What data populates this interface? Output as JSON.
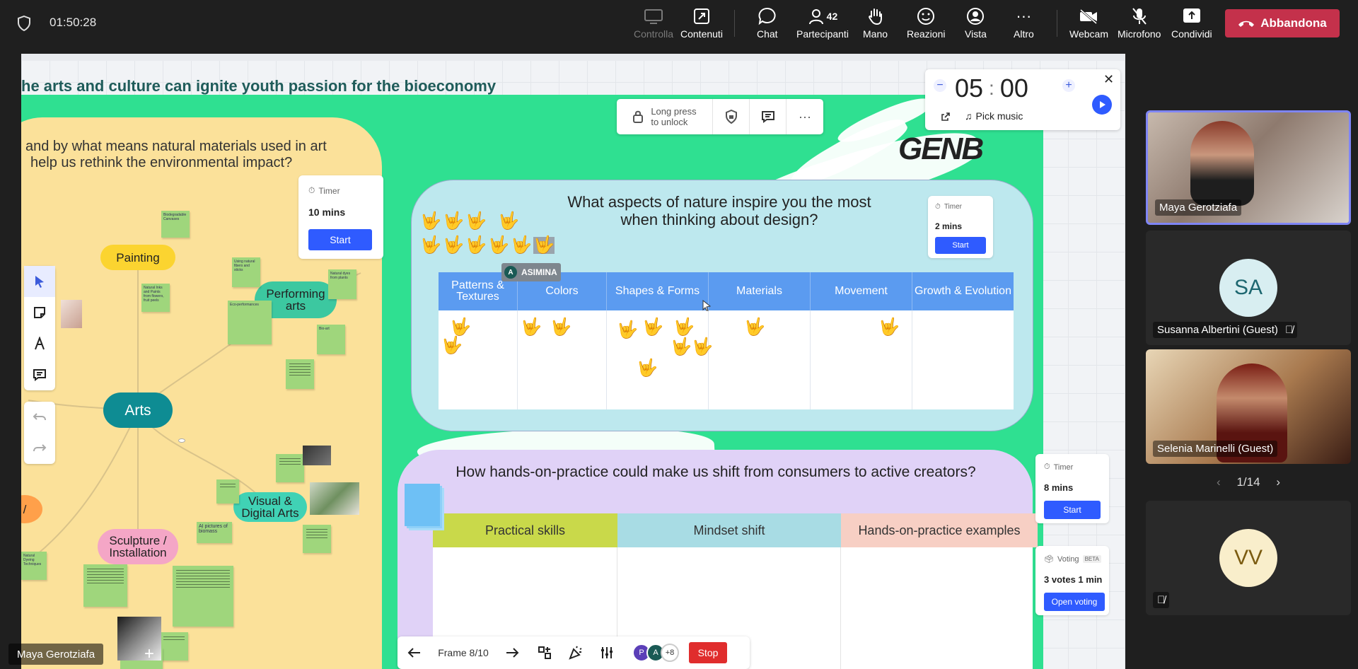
{
  "meeting": {
    "elapsed": "01:50:28",
    "toolbar": {
      "control": "Controlla",
      "content": "Contenuti",
      "chat": "Chat",
      "participants": "Partecipanti",
      "participants_count": "42",
      "hand": "Mano",
      "reactions": "Reazioni",
      "view": "Vista",
      "more": "Altro",
      "webcam": "Webcam",
      "mic": "Microfono",
      "share": "Condividi",
      "leave": "Abbandona"
    },
    "colors": {
      "leave": "#c4314b",
      "accent": "#7f85f5"
    }
  },
  "whiteboard": {
    "slogan": "he arts and culture can ignite youth passion for the bioeconomy",
    "left_question_line1": "and by what means natural materials used in art",
    "left_question_line2": "help us rethink the environmental impact?",
    "mindmap": {
      "center": "Arts",
      "painting": "Painting",
      "performing": "Performing arts",
      "visual": "Visual & Digital Arts",
      "sculpture": "Sculpture / Installation",
      "misc": "/"
    },
    "timer_left": {
      "label": "Timer",
      "value": "10 mins",
      "button": "Start"
    },
    "lock": {
      "text_line1": "Long press",
      "text_line2": "to unlock"
    },
    "big_timer": {
      "minutes": "05",
      "seconds": "00",
      "music": "Pick music"
    },
    "brand": "GENB",
    "board1": {
      "title_line1": "What aspects of nature inspire you the most",
      "title_line2": "when thinking about design?",
      "timer": {
        "label": "Timer",
        "value": "2 mins",
        "button": "Start"
      },
      "columns": [
        "Patterns & Textures",
        "Colors",
        "Shapes & Forms",
        "Materials",
        "Movement",
        "Growth & Evolution"
      ],
      "cursor_user_initial": "A",
      "cursor_user_name": "ASIMINA"
    },
    "board2": {
      "title": "How hands-on-practice could make us shift from consumers to active creators?",
      "columns": [
        "Practical skills",
        "Mindset shift",
        "Hands-on-practice examples"
      ],
      "timer": {
        "label": "Timer",
        "value": "8 mins",
        "button": "Start"
      },
      "voting": {
        "label": "Voting",
        "badge": "BETA",
        "value": "3 votes 1 min",
        "button": "Open voting"
      }
    },
    "frame_bar": {
      "frame": "Frame 8/10",
      "avatar1": "P",
      "avatar2": "A",
      "more": "+8",
      "stop": "Stop"
    },
    "presenter_name": "Maya Gerotziafa",
    "sticky_notes": {
      "n1": "Biodegradable Canvases",
      "n2": "Natural Inks and Paints from flowers, fruit peels",
      "n3": "Natural dyes from plants",
      "n4": "Using natural fibers and sticks",
      "n5": "Eco-performances",
      "n6": "Bio-art",
      "n7": "AI pictures of biomass",
      "n8": "Natural Dyeing Techniques"
    }
  },
  "participants": [
    {
      "name": "Maya Gerotziafa"
    },
    {
      "name": "Susanna Albertini (Guest)",
      "initials": "SA"
    },
    {
      "name": "Selenia Marinelli (Guest)"
    },
    {
      "name": "",
      "initials": "VV"
    }
  ],
  "pager": "1/14"
}
